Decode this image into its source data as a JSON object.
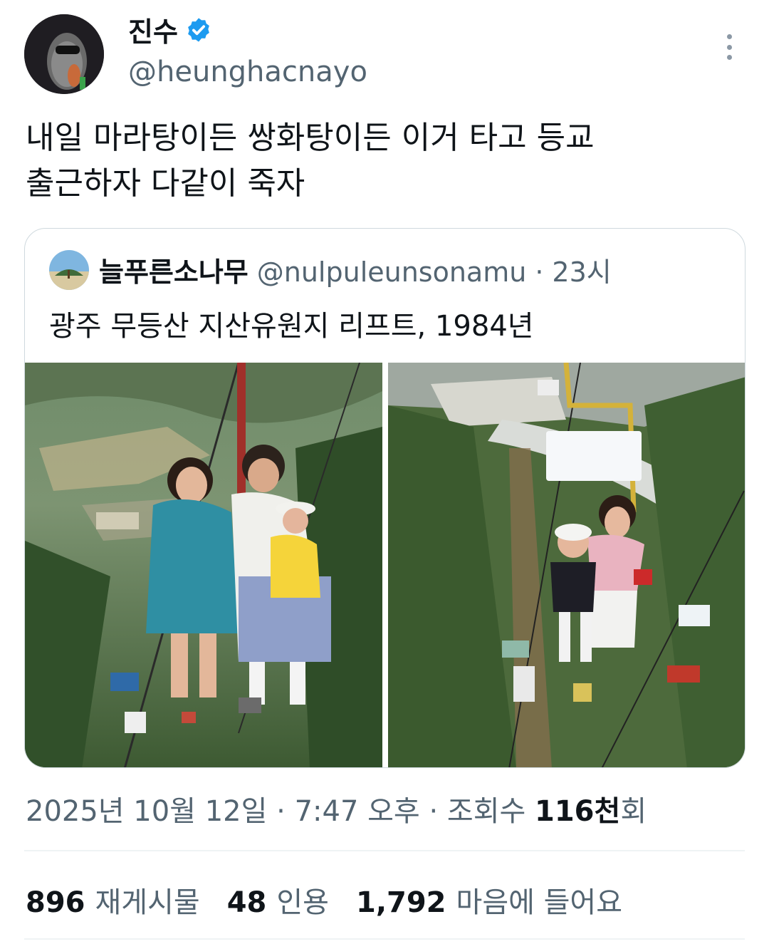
{
  "author": {
    "name": "진수",
    "handle": "@heunghacnayo",
    "verified": true
  },
  "tweet": {
    "lines": [
      "내일 마라탕이든 쌍화탕이든 이거 타고 등교",
      "출근하자 다같이 죽자"
    ]
  },
  "quoted_tweet": {
    "name": "늘푸른소나무",
    "handle": "@nulpuleunsonamu",
    "separator": "·",
    "time": "23시",
    "text": "광주 무등산 지산유원지 리프트, 1984년",
    "photos": [
      "photo-1",
      "photo-2"
    ]
  },
  "meta": {
    "date": "2025년 10월 12일",
    "sep1": "·",
    "time": "7:47 오후",
    "sep2": "·",
    "views_label": "조회수",
    "views_number": "116천",
    "views_suffix": "회"
  },
  "stats": {
    "reposts": "896",
    "reposts_label": "재게시물",
    "quotes": "48",
    "quotes_label": "인용",
    "likes": "1,792",
    "likes_label": "마음에 들어요"
  },
  "colors": {
    "text": "#0f1419",
    "secondary": "#536471",
    "border": "#cfd9de",
    "verified": "#1d9bf0"
  }
}
